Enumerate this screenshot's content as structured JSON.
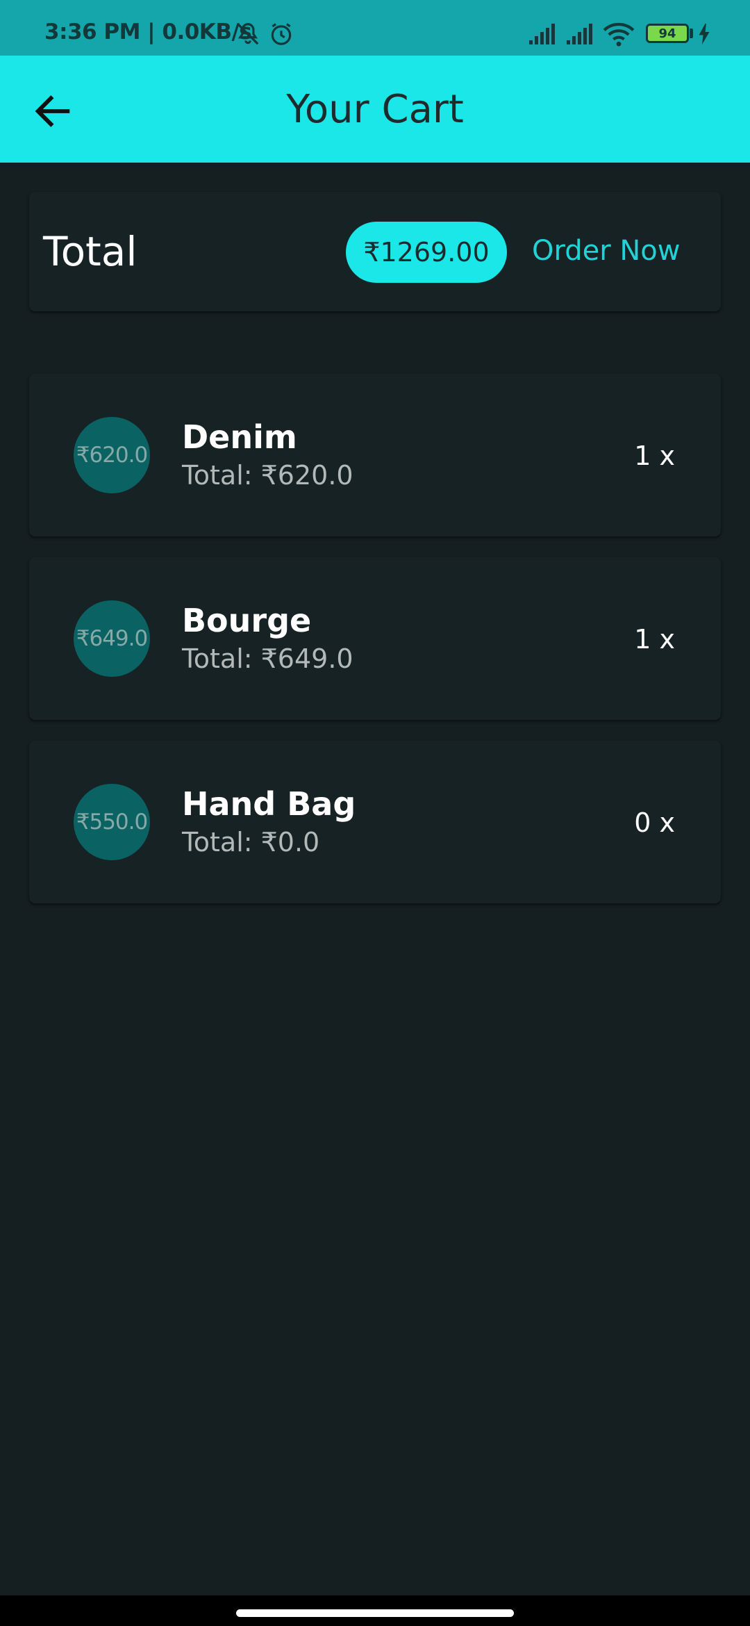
{
  "status_bar": {
    "time": "3:36 PM | 0.0KB/s",
    "battery": "94",
    "icons": [
      "bell-off-icon",
      "alarm-icon",
      "signal-icon",
      "signal-icon",
      "wifi-icon",
      "battery-icon",
      "charging-icon"
    ]
  },
  "app_bar": {
    "title": "Your Cart",
    "back_icon": "arrow-left-icon"
  },
  "summary": {
    "label": "Total",
    "amount": "₹1269.00",
    "order_button": "Order Now"
  },
  "items": [
    {
      "avatar": "₹620.0",
      "name": "Denim",
      "total": "Total: ₹620.0",
      "qty": "1 x"
    },
    {
      "avatar": "₹649.0",
      "name": "Bourge",
      "total": "Total: ₹649.0",
      "qty": "1 x"
    },
    {
      "avatar": "₹550.0",
      "name": "Hand Bag",
      "total": "Total: ₹0.0",
      "qty": "0 x"
    }
  ],
  "colors": {
    "status_bar": "#15a6ac",
    "accent": "#1be7e8",
    "background": "#151e20",
    "card": "#172224",
    "avatar": "#0a6263"
  }
}
